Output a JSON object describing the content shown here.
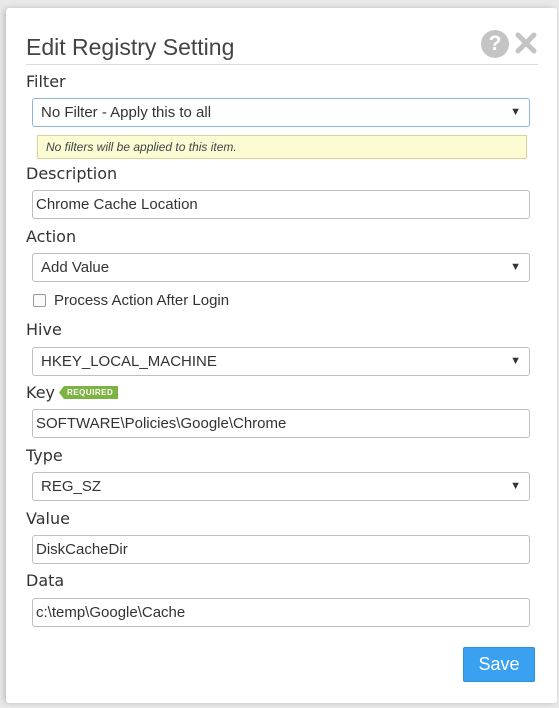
{
  "dialog": {
    "title": "Edit Registry Setting",
    "help_icon": "question-mark-icon",
    "close_icon": "close-x-icon"
  },
  "filter": {
    "label": "Filter",
    "value": "No Filter - Apply this to all",
    "hint": "No filters will be applied to this item."
  },
  "description": {
    "label": "Description",
    "value": "Chrome Cache Location"
  },
  "action": {
    "label": "Action",
    "value": "Add Value",
    "checkbox_label": "Process Action After Login",
    "checkbox_checked": false
  },
  "hive": {
    "label": "Hive",
    "value": "HKEY_LOCAL_MACHINE"
  },
  "key": {
    "label": "Key",
    "badge": "REQUIRED",
    "value": "SOFTWARE\\Policies\\Google\\Chrome"
  },
  "type": {
    "label": "Type",
    "value": "REG_SZ"
  },
  "value": {
    "label": "Value",
    "value": "DiskCacheDir"
  },
  "data": {
    "label": "Data",
    "value": "c:\\temp\\Google\\Cache"
  },
  "save_button": {
    "label": "Save"
  },
  "colors": {
    "accent": "#3aa0f0",
    "required_badge": "#7cb342",
    "hint_background": "#fcfcd4"
  }
}
